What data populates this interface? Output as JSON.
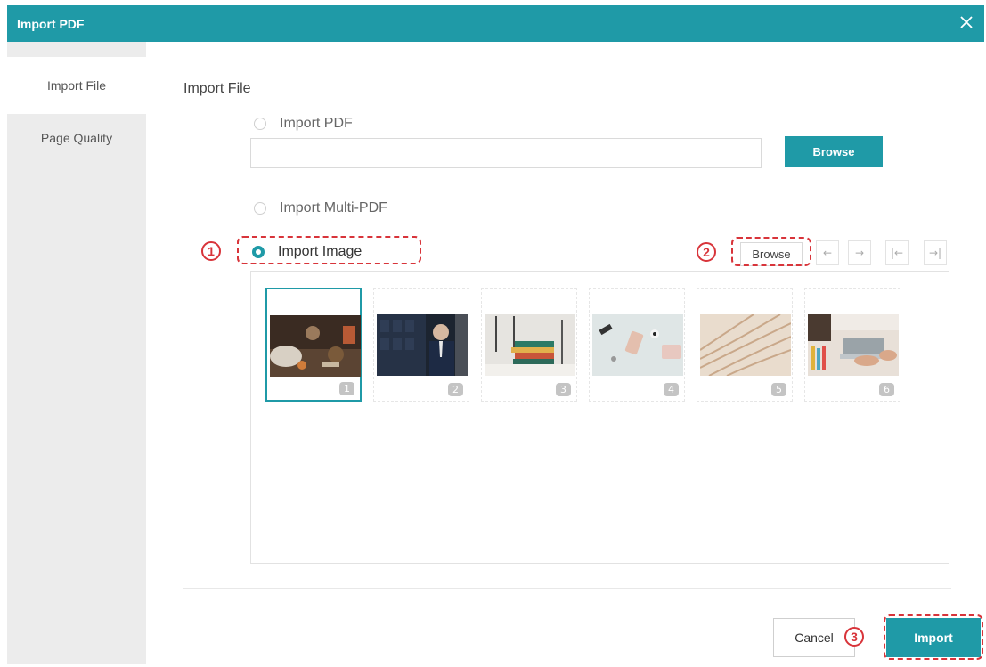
{
  "window": {
    "title": "Import PDF"
  },
  "sidebar": {
    "items": [
      {
        "label": "Import File",
        "active": true
      },
      {
        "label": "Page Quality",
        "active": false
      }
    ]
  },
  "section_title": "Import File",
  "options": {
    "import_pdf": "Import PDF",
    "import_multi_pdf": "Import Multi-PDF",
    "import_image": "Import Image",
    "selected": "import_image"
  },
  "pdf_path": {
    "value": "",
    "placeholder": ""
  },
  "buttons": {
    "browse_pdf": "Browse",
    "browse_images": "Browse",
    "cancel": "Cancel",
    "import": "Import"
  },
  "paging_icons": [
    "arrow-left-icon",
    "arrow-right-icon",
    "first-page-icon",
    "last-page-icon"
  ],
  "thumbnails": [
    {
      "number": "1",
      "selected": true
    },
    {
      "number": "2",
      "selected": false
    },
    {
      "number": "3",
      "selected": false
    },
    {
      "number": "4",
      "selected": false
    },
    {
      "number": "5",
      "selected": false
    },
    {
      "number": "6",
      "selected": false
    }
  ],
  "annotations": [
    "1",
    "2",
    "3"
  ],
  "colors": {
    "accent": "#1f9aa7",
    "annotation": "#d8343a",
    "sidebar_bg": "#ececec"
  }
}
